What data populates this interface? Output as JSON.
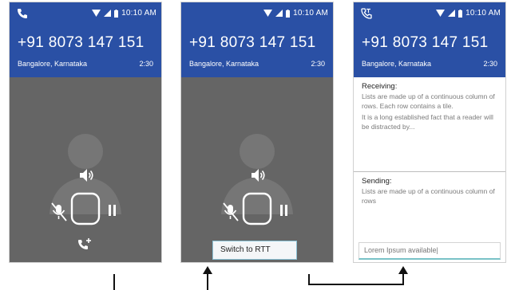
{
  "screens": [
    {
      "status": {
        "time": "10:10 AM",
        "call_icon": "phone-icon"
      },
      "call": {
        "number": "+91 8073 147 151",
        "location": "Bangalore, Karnataka",
        "duration": "2:30"
      },
      "controls": [
        "speaker-icon",
        "mute-icon",
        "pause-icon",
        "add-call-icon"
      ]
    },
    {
      "status": {
        "time": "10:10 AM"
      },
      "call": {
        "number": "+91 8073 147 151",
        "location": "Bangalore, Karnataka",
        "duration": "2:30"
      },
      "menu_option": "Switch to RTT"
    },
    {
      "status": {
        "time": "10:10 AM",
        "call_icon": "rtt-call-icon"
      },
      "call": {
        "number": "+91 8073 147 151",
        "location": "Bangalore, Karnataka",
        "duration": "2:30"
      },
      "rtt": {
        "receiving_label": "Receiving:",
        "receiving_text_1": "Lists are made up of a continuous column of rows. Each row contains a tile.",
        "receiving_text_2": "It is a long established fact that a reader will be distracted by...",
        "sending_label": "Sending:",
        "sending_text": "Lists are made up of a continuous column of rows",
        "input_value": "Lorem Ipsum available|"
      }
    }
  ],
  "colors": {
    "header": "#2a50a5",
    "call_bg": "#656565",
    "avatar": "#767676",
    "input_accent": "#79c2c7",
    "popup_border": "#8dc4d8"
  }
}
